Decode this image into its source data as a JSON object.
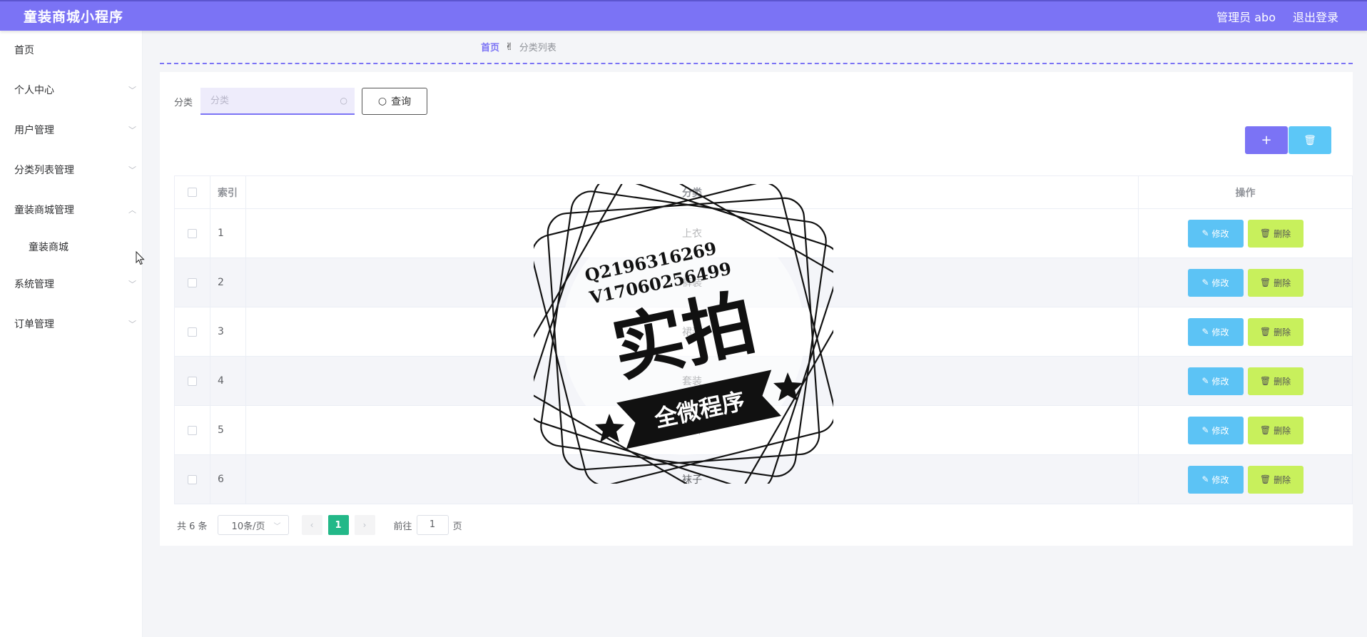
{
  "header": {
    "brand": "童装商城小程序",
    "user_label": "管理员 abo",
    "logout_label": "退出登录"
  },
  "sidebar": {
    "items": [
      {
        "label": "首页",
        "has_children": false
      },
      {
        "label": "个人中心",
        "has_children": true
      },
      {
        "label": "用户管理",
        "has_children": true
      },
      {
        "label": "分类列表管理",
        "has_children": true
      },
      {
        "label": "童装商城管理",
        "has_children": true,
        "expanded": true
      },
      {
        "label": "系统管理",
        "has_children": true
      },
      {
        "label": "订单管理",
        "has_children": true
      }
    ],
    "sub_item": "童装商城"
  },
  "breadcrumb": {
    "home": "首页",
    "separator_icon": "hand-icon",
    "current": "分类列表"
  },
  "search": {
    "label": "分类",
    "placeholder": "分类",
    "value": "",
    "button_label": "查询"
  },
  "toolbar": {
    "add_icon": "plus-icon",
    "bulk_delete_icon": "trash-icon"
  },
  "table": {
    "columns": [
      "索引",
      "分类",
      "操作"
    ],
    "rows": [
      {
        "index": "1",
        "category": "上衣"
      },
      {
        "index": "2",
        "category": "裤装"
      },
      {
        "index": "3",
        "category": "裙装"
      },
      {
        "index": "4",
        "category": "套装"
      },
      {
        "index": "5",
        "category": "内裤"
      },
      {
        "index": "6",
        "category": "袜子"
      }
    ],
    "edit_label": "修改",
    "delete_label": "删除"
  },
  "pagination": {
    "total_text": "共 6 条",
    "page_size": "10条/页",
    "current_page": "1",
    "goto_prefix": "前往",
    "goto_value": "1",
    "goto_suffix": "页"
  },
  "watermark": {
    "line1": "Q2196316269",
    "line2": "V17060256499",
    "big_text": "实拍",
    "banner_text": "全微程序"
  },
  "colors": {
    "primary": "#7b73f5",
    "info": "#5cc3f5",
    "lime": "#c8f05c",
    "success": "#23b888"
  }
}
